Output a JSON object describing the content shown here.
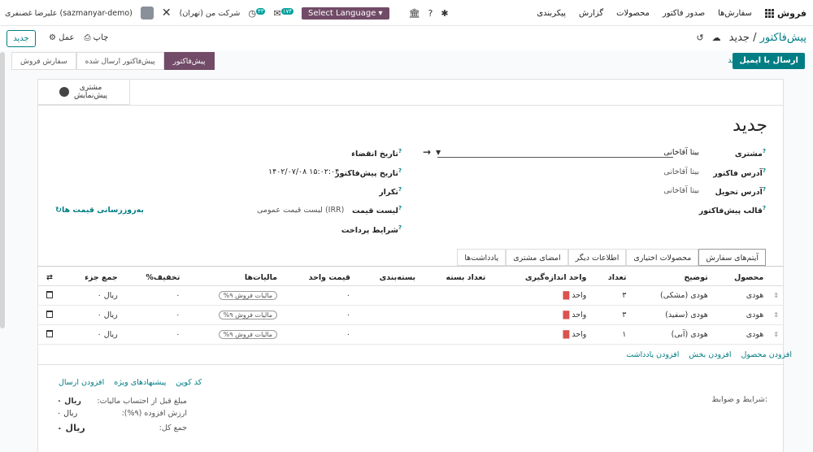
{
  "nav": {
    "brand": "فروش",
    "menu": [
      "سفارش‌ها",
      "صدور فاکتور",
      "محصولات",
      "گزارش",
      "پیکربندی"
    ],
    "lang_label": "Select Language",
    "company": "شرکت من (تهران)",
    "user": "علیرضا غضنفری (sazmanyar-demo)",
    "msg_badge": "۱۷۴",
    "activity_badge": "۴۳"
  },
  "toolbar": {
    "new_label": "جدید",
    "print_label": "چاپ",
    "action_label": "عمل",
    "breadcrumb_parent": "پیش‌فاکتور",
    "breadcrumb_current": "جدید"
  },
  "status": {
    "send_email": "ارسال با ایمیل",
    "confirm": "تایید",
    "stages": [
      "پیش‌فاکتور",
      "پیش‌فاکتور ارسال شده",
      "سفارش فروش"
    ],
    "active_stage": "پیش‌فاکتور"
  },
  "smart": {
    "line1": "مشتری",
    "line2": "پیش‌نمایش"
  },
  "form": {
    "title": "جدید",
    "customer_label": "مشتری",
    "customer_value": "بیتا آقاخانی",
    "invoice_addr_label": "آدرس فاکتور",
    "invoice_addr_value": "بیتا آقاخانی",
    "delivery_addr_label": "آدرس تحویل",
    "delivery_addr_value": "بیتا آقاخانی",
    "template_label": "قالب پیش‌فاکتور",
    "expiry_label": "تاریخ انقضاء",
    "quote_date_label": "تاریخ پیش‌فاکتور",
    "quote_date_value": "۱۴۰۲/۰۷/۰۸ ۱۵:۰۲:۰۴",
    "recurrence_label": "تکرار",
    "pricelist_label": "لیست قیمت",
    "pricelist_value": "لیست قیمت عمومی (IRR)",
    "update_prices": "به‌روزرسانی قیمت ها",
    "payment_terms_label": "شرایط پرداخت"
  },
  "tabs": [
    "آیتم‌های سفارش",
    "محصولات اختیاری",
    "اطلاعات دیگر",
    "امضای مشتری",
    "یادداشت‌ها"
  ],
  "table": {
    "headers": [
      "محصول",
      "توضیح",
      "تعداد",
      "واحد اندازه‌گیری",
      "تعداد بسته",
      "بسته‌بندی",
      "قیمت واحد",
      "مالیات‌ها",
      "تخفیف%",
      "جمع جزء"
    ],
    "rows": [
      {
        "product": "هودی",
        "desc": "هودی (مشکی)",
        "qty": "۳",
        "uom": "واحد",
        "price": "۰",
        "tax": "مالیات فروش ۹%",
        "disc": "۰",
        "subtotal": "ریال ۰"
      },
      {
        "product": "هودی",
        "desc": "هودی (سفید)",
        "qty": "۳",
        "uom": "واحد",
        "price": "۰",
        "tax": "مالیات فروش ۹%",
        "disc": "۰",
        "subtotal": "ریال ۰"
      },
      {
        "product": "هودی",
        "desc": "هودی (آبی)",
        "qty": "۱",
        "uom": "واحد",
        "price": "۰",
        "tax": "مالیات فروش ۹%",
        "disc": "۰",
        "subtotal": "ریال ۰"
      }
    ]
  },
  "add_links": [
    "افزودن محصول",
    "افزودن بخش",
    "افزودن یادداشت"
  ],
  "bottom_links": [
    "کد کوپن",
    "پیشنهادهای ویژه",
    "افزودن ارسال"
  ],
  "terms_label": "شرایط و ضوابط:",
  "totals": {
    "untaxed_label": "مبلغ قبل از احتساب مالیات:",
    "untaxed_value": "ریال ۰",
    "vat_label": "ارزش افزوده (۹%):",
    "vat_value": "ریال ۰",
    "total_label": "جمع کل:",
    "total_value": "ریال ۰"
  }
}
